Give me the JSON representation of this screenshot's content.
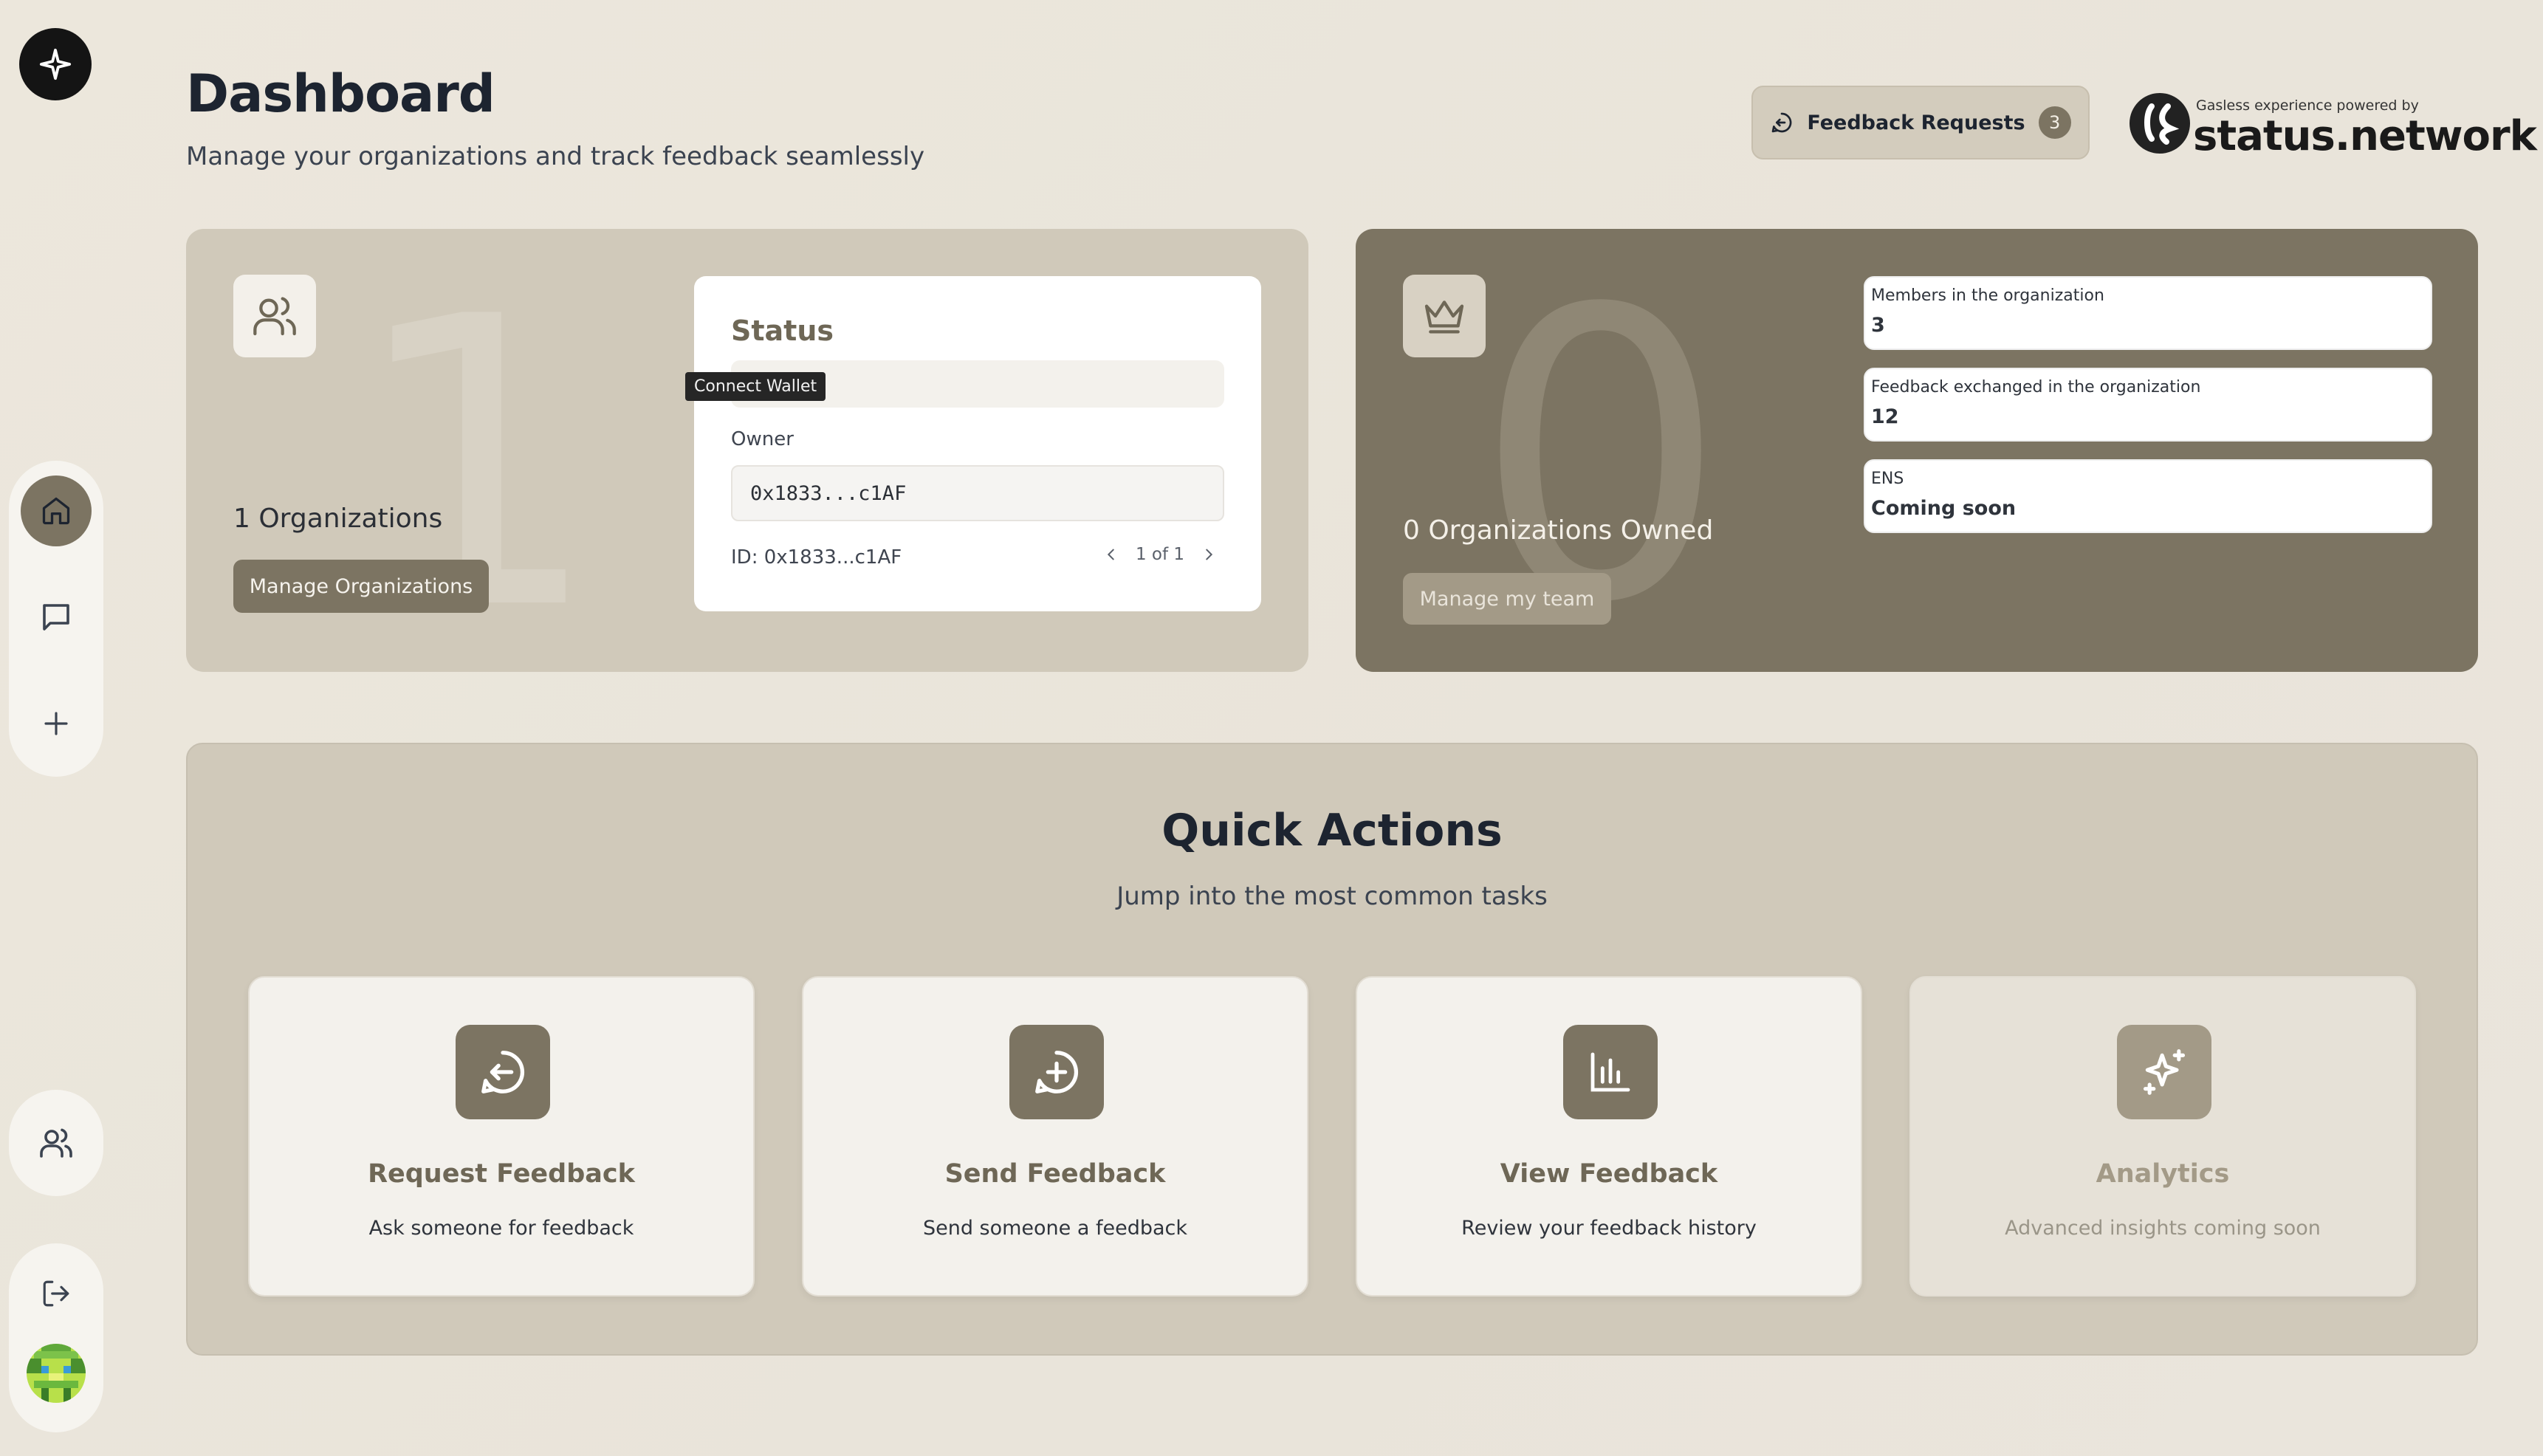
{
  "header": {
    "title": "Dashboard",
    "subtitle": "Manage your organizations and track feedback seamlessly",
    "feedback_requests_label": "Feedback Requests",
    "feedback_requests_count": "3",
    "brand_tagline": "Gasless experience powered by",
    "brand_name": "status.network"
  },
  "organizations_card": {
    "big_number": "1",
    "count_label": "1 Organizations",
    "manage_button": "Manage Organizations",
    "status": {
      "title": "Status",
      "tooltip": "Connect Wallet",
      "owner_label": "Owner",
      "owner_value": "0x1833...c1AF",
      "id_label": "ID: 0x1833...c1AF",
      "pager_text": "1 of 1"
    }
  },
  "owned_card": {
    "big_number": "0",
    "count_label": "0 Organizations Owned",
    "manage_button": "Manage my team",
    "stats": [
      {
        "label": "Members in the organization",
        "value": "3"
      },
      {
        "label": "Feedback exchanged in the organization",
        "value": "12"
      },
      {
        "label": "ENS",
        "value": "Coming soon"
      }
    ]
  },
  "quick_actions": {
    "title": "Quick Actions",
    "subtitle": "Jump into the most common tasks",
    "actions": [
      {
        "title": "Request Feedback",
        "description": "Ask someone for feedback",
        "icon": "request-feedback-icon"
      },
      {
        "title": "Send Feedback",
        "description": "Send someone a feedback",
        "icon": "send-feedback-icon"
      },
      {
        "title": "View Feedback",
        "description": "Review your feedback history",
        "icon": "bar-chart-icon"
      },
      {
        "title": "Analytics",
        "description": "Advanced insights coming soon",
        "icon": "sparkles-icon"
      }
    ]
  },
  "sidebar": {
    "items": [
      "home-icon",
      "chat-icon",
      "plus-icon",
      "users-icon",
      "logout-icon"
    ]
  },
  "colors": {
    "accent": "#7c7462",
    "background": "#ebe6dc",
    "card_light": "#d0c9ba"
  }
}
